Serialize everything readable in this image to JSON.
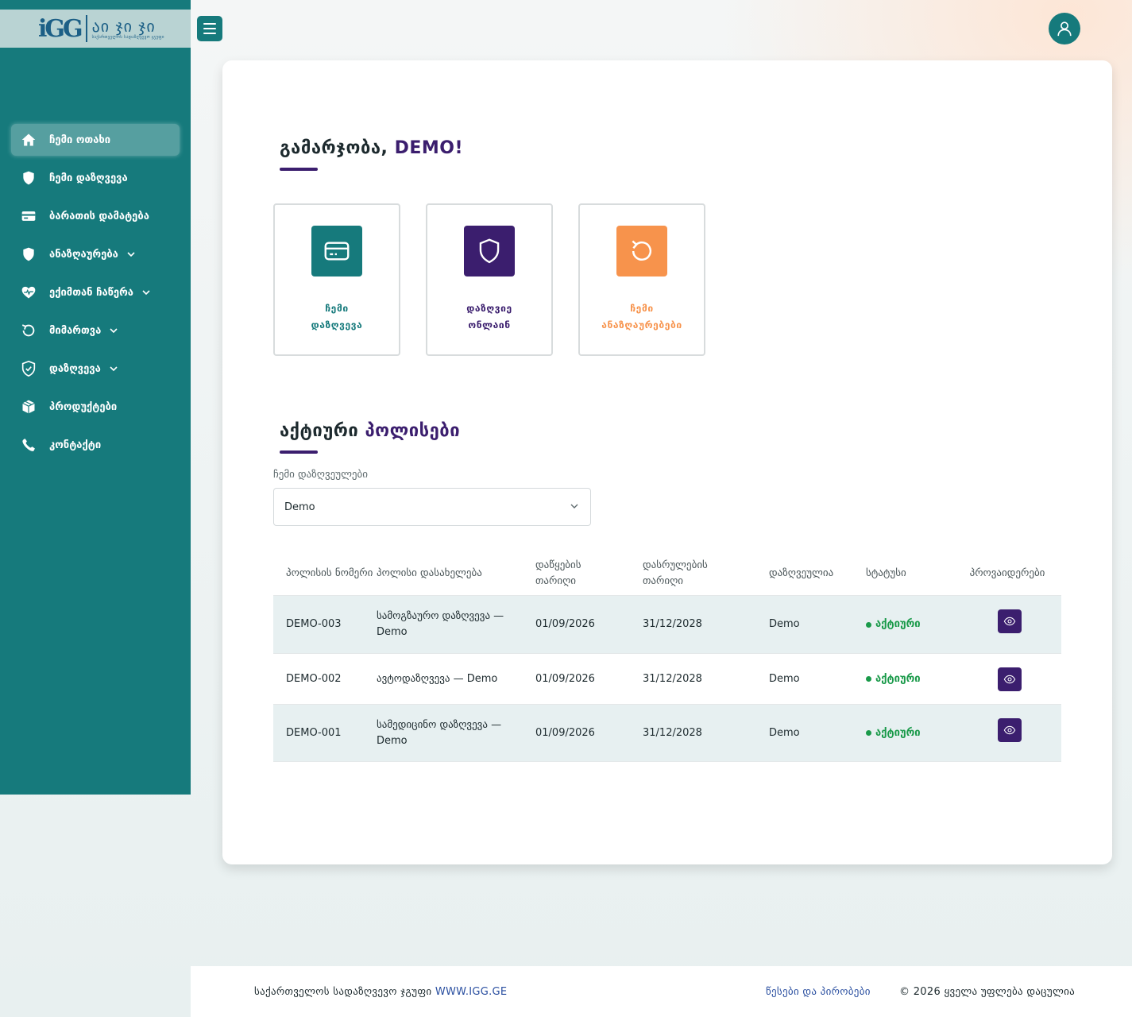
{
  "brand": {
    "logo_mark": "iGG",
    "logo_word": "აი ჯი ჯი",
    "logo_subtitle": "საქართველოს სადაზღვევო ჯგუფი",
    "primary_color": "#167a7c",
    "accent_color": "#3b1e6e",
    "orange_color": "#f7934c"
  },
  "sidebar": {
    "items": [
      {
        "label": "ჩემი ოთახი",
        "icon": "home-icon",
        "active": true
      },
      {
        "label": "ჩემი დაზღვევა",
        "icon": "shield-icon"
      },
      {
        "label": "ბარათის დამატება",
        "icon": "card-icon"
      },
      {
        "label": "ანაზღაურება",
        "icon": "shield-icon",
        "has_dropdown": true
      },
      {
        "label": "ექიმთან ჩაწერა",
        "icon": "heart-pulse-icon",
        "has_dropdown": true
      },
      {
        "label": "მიმართვა",
        "icon": "refresh-icon",
        "has_dropdown": true
      },
      {
        "label": "დაზღვევა",
        "icon": "shield-check-icon",
        "has_dropdown": true
      },
      {
        "label": "პროდუქტები",
        "icon": "box-icon"
      },
      {
        "label": "კონტაქტი",
        "icon": "phone-icon"
      }
    ]
  },
  "greeting": {
    "prefix": "გამარჯობა, ",
    "name": "DEMO!"
  },
  "tiles": [
    {
      "label": "ჩემი\nდაზღვევა",
      "icon": "card-icon",
      "color": "#167a7c"
    },
    {
      "label": "დაზღვიე\nონლაინ",
      "icon": "shield-icon",
      "color": "#3b1e6e"
    },
    {
      "label": "ჩემი\nანაზღაურებები",
      "icon": "refresh-icon",
      "color": "#f7934c"
    }
  ],
  "policies": {
    "title_plain": "აქტიური ",
    "title_accent": "პოლისები",
    "select_label": "ჩემი დაზღვეულები",
    "select_value": "Demo",
    "columns": [
      "პოლისის ნომერი",
      "პოლისი დასახელება",
      "დაწყების თარიღი",
      "დასრულების თარიღი",
      "დაზღვეულია",
      "სტატუსი",
      "პროვაიდერები"
    ],
    "rows": [
      {
        "number": "DEMO-003",
        "name": "სამოგზაურო დაზღვევა — Demo",
        "start": "01/09/2026",
        "end": "31/12/2028",
        "insured": "Demo",
        "status": "აქტიური"
      },
      {
        "number": "DEMO-002",
        "name": "ავტოდაზღვევა — Demo",
        "start": "01/09/2026",
        "end": "31/12/2028",
        "insured": "Demo",
        "status": "აქტიური"
      },
      {
        "number": "DEMO-001",
        "name": "სამედიცინო დაზღვევა — Demo",
        "start": "01/09/2026",
        "end": "31/12/2028",
        "insured": "Demo",
        "status": "აქტიური"
      }
    ]
  },
  "footer": {
    "company": "საქართველოს სადაზღვევო ჯგუფი ",
    "site": "WWW.IGG.GE",
    "terms": "წესები და პირობები",
    "copyright": "© 2026 ყველა უფლება დაცულია"
  }
}
